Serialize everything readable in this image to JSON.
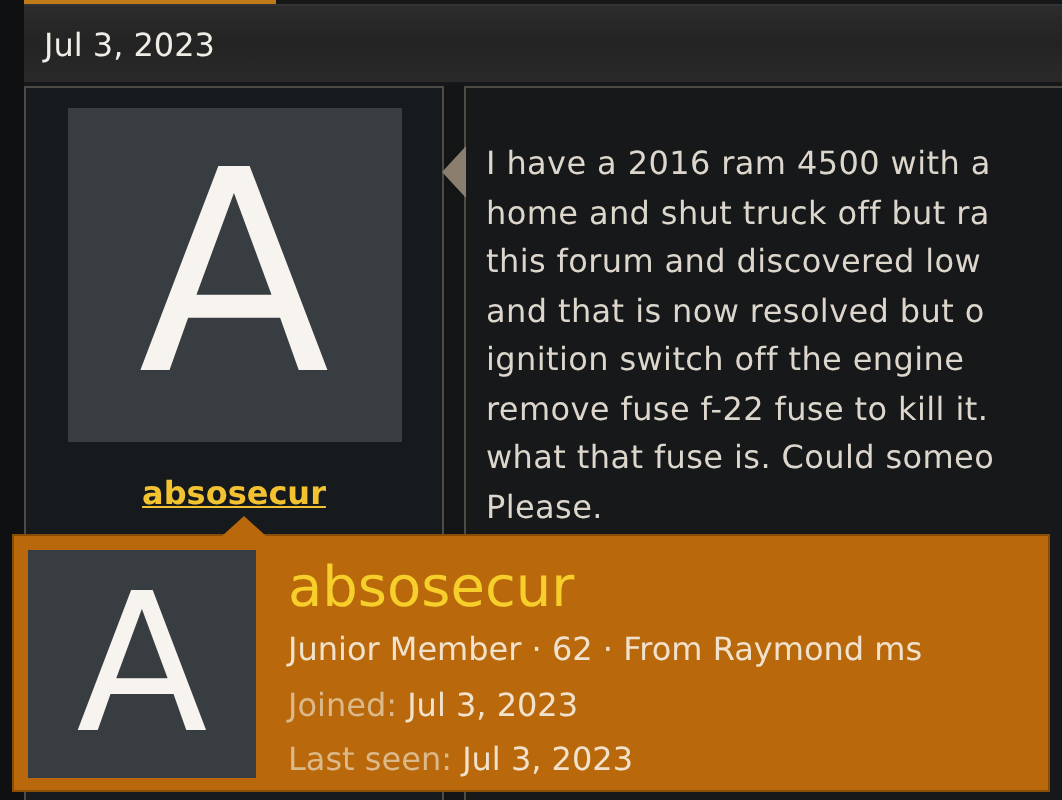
{
  "date_header": "Jul 3, 2023",
  "user": {
    "avatar_letter": "A",
    "name": "absosecur"
  },
  "message": {
    "lines": [
      "I have a 2016 ram 4500 with a",
      "home and shut truck off but ra",
      "this forum and discovered low",
      "and that is now resolved but o",
      "ignition switch off the engine",
      "remove fuse f-22 fuse to kill it.",
      "what that fuse is. Could someo",
      "Please."
    ]
  },
  "tooltip": {
    "avatar_letter": "A",
    "name": "absosecur",
    "info": "Junior Member · 62 · From Raymond ms",
    "stats": [
      {
        "label": "Joined:",
        "value": "Jul 3, 2023"
      },
      {
        "label": "Last seen:",
        "value": "Jul 3, 2023"
      }
    ]
  }
}
